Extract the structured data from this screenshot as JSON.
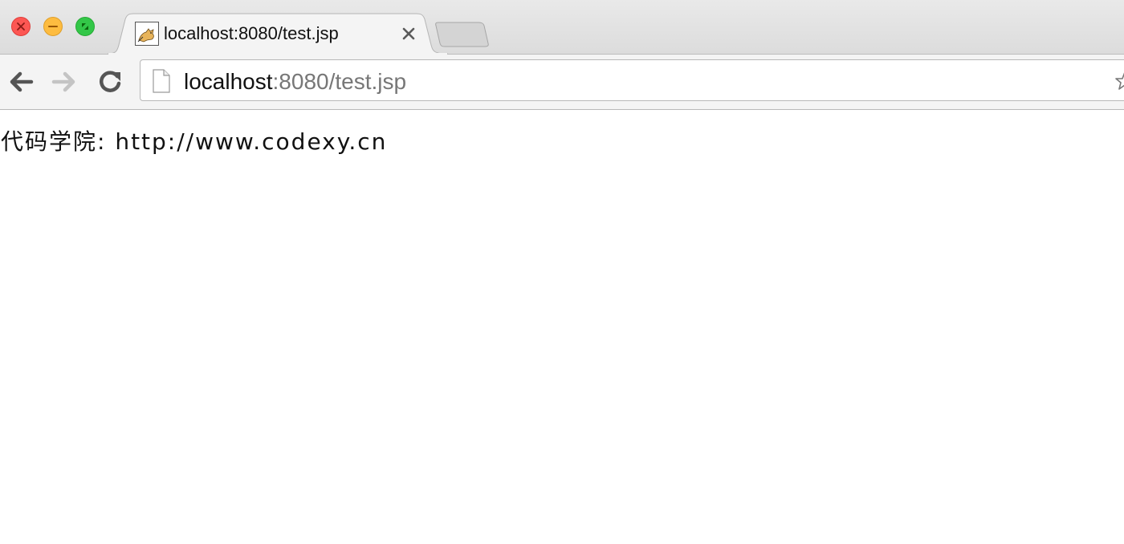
{
  "window": {
    "controls": {
      "close": {
        "icon": "close-icon",
        "color": "#fc5753"
      },
      "minimize": {
        "icon": "minimize-icon",
        "color": "#fdbc40"
      },
      "maximize": {
        "icon": "fullscreen-icon",
        "color": "#33c748"
      }
    }
  },
  "tabs": [
    {
      "title": "localhost:8080/test.jsp",
      "favicon": "tomcat-icon",
      "active": true,
      "close_icon": "close-icon"
    }
  ],
  "new_tab": {
    "icon": "new-tab-icon"
  },
  "toolbar": {
    "back_icon": "arrow-left-icon",
    "forward_icon": "arrow-right-icon",
    "reload_icon": "reload-icon",
    "address": {
      "page_icon": "page-icon",
      "host": "localhost",
      "rest": ":8080/test.jsp",
      "star_icon": "star-icon"
    }
  },
  "page": {
    "text": "代码学院: http://www.codexy.cn"
  }
}
